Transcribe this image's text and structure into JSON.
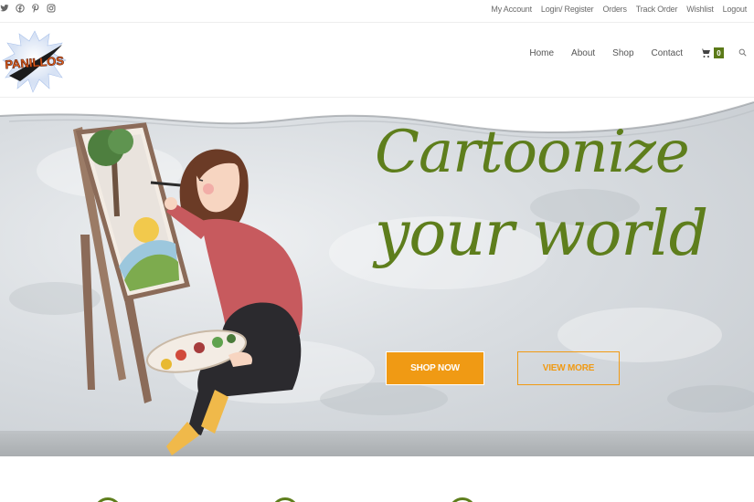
{
  "topbar": {
    "social": [
      {
        "icon": "twitter-icon"
      },
      {
        "icon": "facebook-icon"
      },
      {
        "icon": "pinterest-icon"
      },
      {
        "icon": "instagram-icon"
      }
    ],
    "links": [
      "My Account",
      "Login/ Register",
      "Orders",
      "Track Order",
      "Wishlist",
      "Logout"
    ]
  },
  "header": {
    "logo_text": "PANILLOS",
    "nav": [
      "Home",
      "About",
      "Shop",
      "Contact"
    ],
    "cart_count": "0",
    "cart_icon": "cart-icon",
    "search_icon": "search-icon"
  },
  "hero": {
    "headline_line1": "Cartoonize",
    "headline_line2": "your world",
    "shop_button": "SHOP NOW",
    "view_button": "VIEW MORE"
  },
  "colors": {
    "brand_green": "#5e7e1c",
    "accent_orange": "#f09a14",
    "cart_badge": "#5b7a18"
  }
}
